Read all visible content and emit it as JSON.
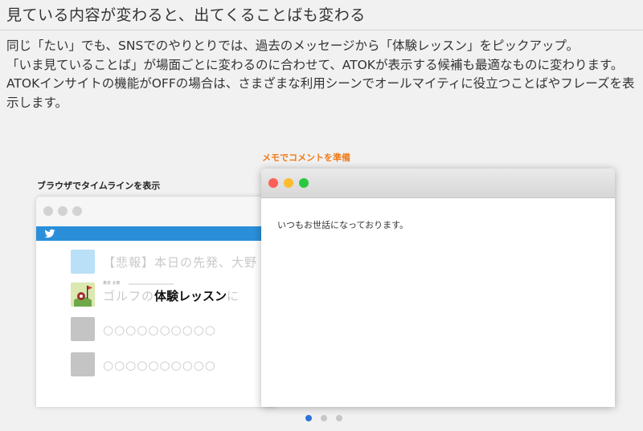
{
  "heading": "見ている内容が変わると、出てくることばも変わる",
  "description": {
    "lines": [
      "同じ「たい」でも、SNSでのやりとりでは、過去のメッセージから「体験レッスン」をピックアップ。",
      "「いま見ていることば」が場面ごとに変わるのに合わせて、ATOKが表示する候補も最適なものに変わります。",
      "ATOKインサイトの機能がOFFの場合は、さまざまな利用シーンでオールマイティに役立つことばやフレーズを表示します。"
    ]
  },
  "browser": {
    "label": "ブラウザでタイムラインを表示",
    "icon": "twitter-bird-icon",
    "items": [
      {
        "text": "【悲報】本日の先発、大野",
        "thumb_color": "#b9e0f6"
      },
      {
        "small_name": "東京 太郎",
        "text_pre": "ゴルフの",
        "text_highlight": "体験レッスン",
        "text_post": "に",
        "thumb_color": "#d8e6a8"
      },
      {
        "text": "○○○○○○○○○○",
        "thumb_color": "#c4c4c4"
      },
      {
        "text": "○○○○○○○○○○",
        "thumb_color": "#c4c4c4"
      }
    ]
  },
  "memo": {
    "label": "メモでコメントを準備",
    "body": "いつもお世話になっております。"
  },
  "colors": {
    "accent_orange": "#f07b1a",
    "twitter_blue": "#2a8fd8",
    "pager_active": "#2a73d8",
    "close": "#fc5f57",
    "minimize": "#fdbc2e",
    "zoom": "#2ac840"
  },
  "pager": {
    "count": 3,
    "active_index": 0
  }
}
